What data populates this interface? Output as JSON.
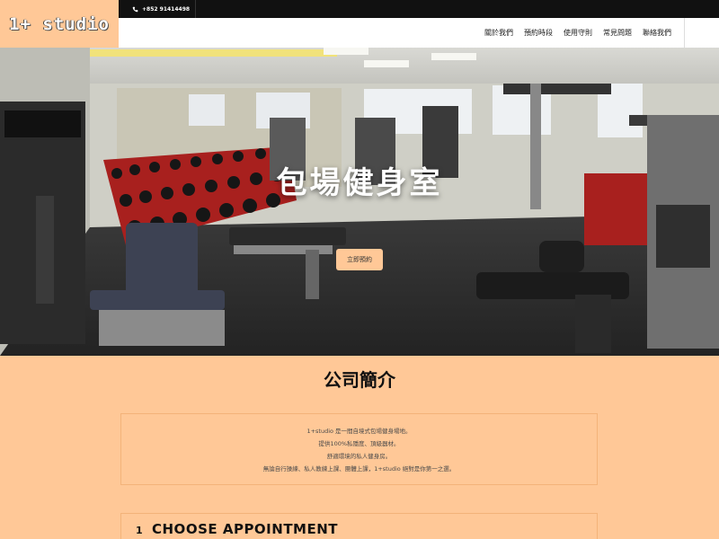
{
  "logo": {
    "text": "1+ studio"
  },
  "topbar": {
    "phone": "+852 91414498",
    "phone_icon": "phone-icon"
  },
  "nav": {
    "items": [
      {
        "label": "關於我們"
      },
      {
        "label": "預約時段"
      },
      {
        "label": "使用守則"
      },
      {
        "label": "常見問題"
      },
      {
        "label": "聯絡我們"
      }
    ]
  },
  "hero": {
    "title": "包場健身室",
    "button_label": "立即預約",
    "image": "gym-interior-photo"
  },
  "company": {
    "title": "公司簡介",
    "lines": [
      "1+studio 是一間自境式包場健身場地。",
      "提供100%私隱度、頂級器材。",
      "舒適環境的私人健身房。",
      "無論自行操練、私人教練上課、團體上課，1+studio 絕對是你第一之選。"
    ]
  },
  "appointment": {
    "number": "1",
    "title": "CHOOSE APPOINTMENT"
  },
  "colors": {
    "accent": "#ffc897",
    "topbar": "#111111",
    "border": "#f3b37a"
  }
}
